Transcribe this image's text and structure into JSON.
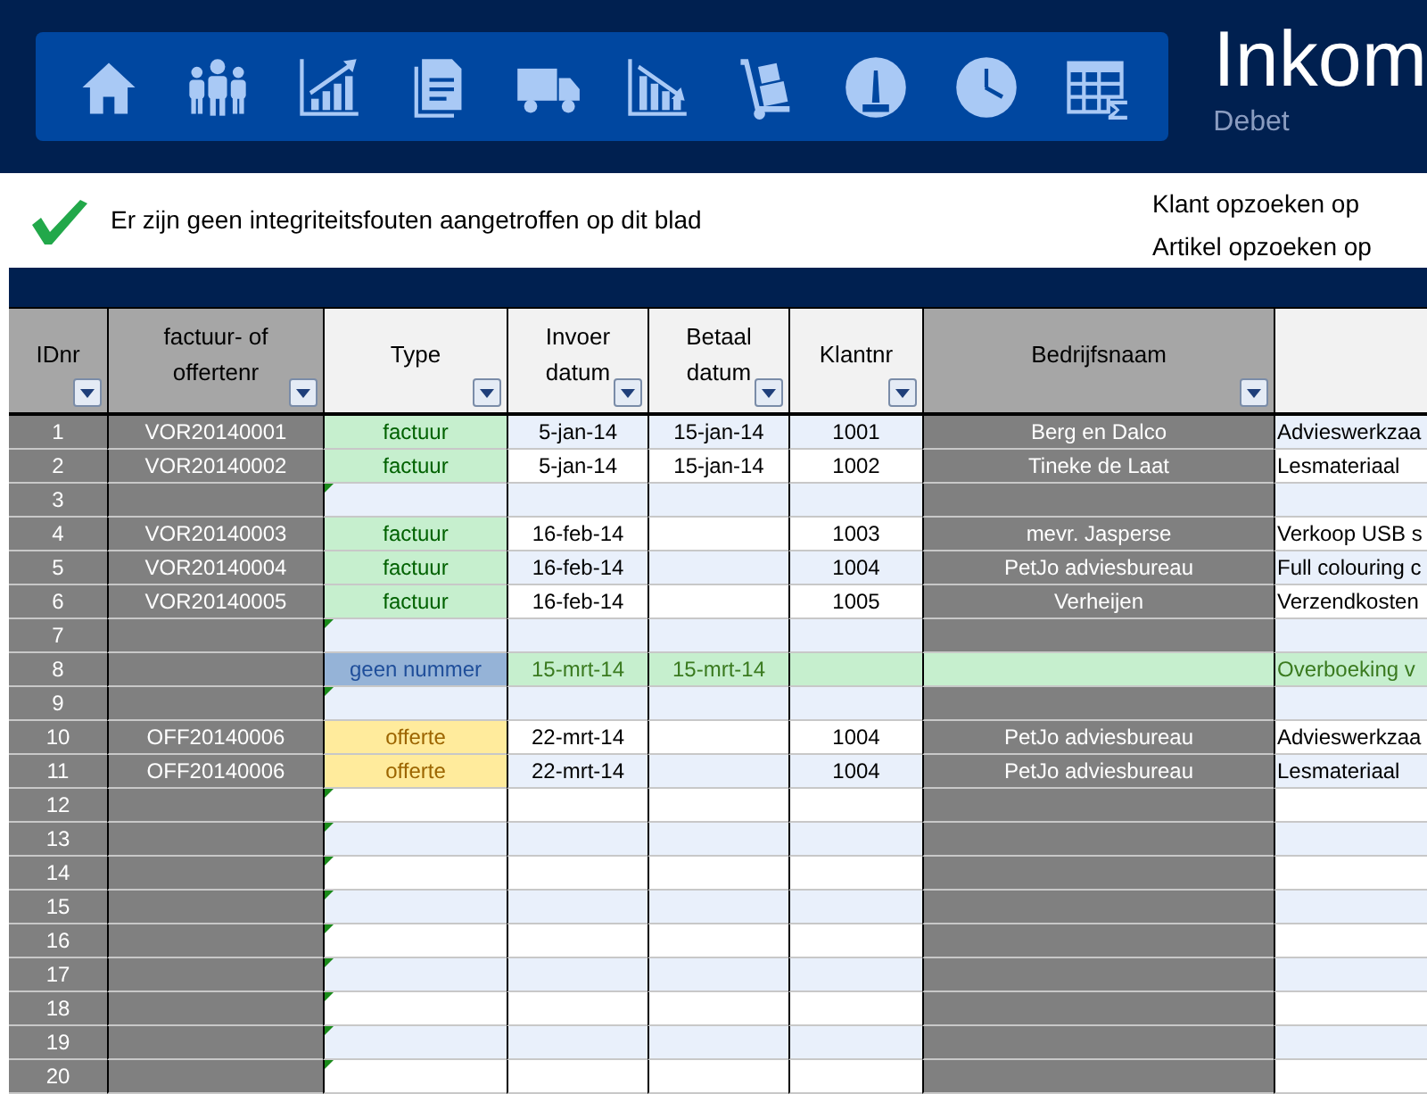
{
  "header": {
    "title": "Inkom",
    "subtitle": "Debet"
  },
  "status": {
    "ok": true,
    "message": "Er zijn geen integriteitsfouten aangetroffen op dit blad"
  },
  "links": [
    "Klant opzoeken op",
    "Artikel opzoeken op"
  ],
  "table": {
    "columns": [
      {
        "label": "IDnr",
        "filter": true,
        "kind": "locked"
      },
      {
        "label": "factuur- of\noffertenr",
        "filter": true,
        "kind": "locked"
      },
      {
        "label": "Type",
        "filter": true,
        "kind": "input"
      },
      {
        "label": "Invoer\ndatum",
        "filter": true,
        "kind": "input"
      },
      {
        "label": "Betaal\ndatum",
        "filter": true,
        "kind": "input"
      },
      {
        "label": "Klantnr",
        "filter": true,
        "kind": "input"
      },
      {
        "label": "Bedrijfsnaam",
        "filter": true,
        "kind": "locked"
      },
      {
        "filter": false,
        "kind": "input"
      }
    ],
    "rows": [
      {
        "highlighted": false,
        "cells": [
          "1",
          "VOR20140001",
          {
            "text": "factuur",
            "kind": "invoice"
          },
          "5-jan-14",
          "15-jan-14",
          "1001",
          "Berg en Dalco",
          "Advieswerkzaa"
        ]
      },
      {
        "highlighted": false,
        "cells": [
          "2",
          "VOR20140002",
          {
            "text": "factuur",
            "kind": "invoice"
          },
          "5-jan-14",
          "15-jan-14",
          "1002",
          "Tineke de Laat",
          "Lesmateriaal"
        ]
      },
      {
        "highlighted": false,
        "cells": [
          "3"
        ]
      },
      {
        "highlighted": false,
        "cells": [
          "4",
          "VOR20140003",
          {
            "text": "factuur",
            "kind": "invoice"
          },
          "16-feb-14",
          null,
          "1003",
          "mevr.  Jasperse",
          "Verkoop USB s"
        ]
      },
      {
        "highlighted": false,
        "cells": [
          "5",
          "VOR20140004",
          {
            "text": "factuur",
            "kind": "invoice"
          },
          "16-feb-14",
          null,
          "1004",
          "PetJo adviesbureau",
          "Full colouring c"
        ]
      },
      {
        "highlighted": false,
        "cells": [
          "6",
          "VOR20140005",
          {
            "text": "factuur",
            "kind": "invoice"
          },
          "16-feb-14",
          null,
          "1005",
          "Verheijen",
          "Verzendkosten"
        ]
      },
      {
        "highlighted": false,
        "cells": [
          "7"
        ]
      },
      {
        "highlighted": true,
        "cells": [
          "8",
          null,
          {
            "text": "geen nummer",
            "kind": "none"
          },
          "15-mrt-14",
          "15-mrt-14",
          null,
          null,
          "Overboeking v"
        ]
      },
      {
        "highlighted": false,
        "cells": [
          "9"
        ]
      },
      {
        "highlighted": false,
        "cells": [
          "10",
          "OFF20140006",
          {
            "text": "offerte",
            "kind": "quote"
          },
          "22-mrt-14",
          null,
          "1004",
          "PetJo adviesbureau",
          "Advieswerkzaa"
        ]
      },
      {
        "highlighted": false,
        "cells": [
          "11",
          "OFF20140006",
          {
            "text": "offerte",
            "kind": "quote"
          },
          "22-mrt-14",
          null,
          "1004",
          "PetJo adviesbureau",
          "Lesmateriaal"
        ]
      },
      {
        "highlighted": false,
        "cells": [
          "12"
        ]
      },
      {
        "highlighted": false,
        "cells": [
          "13"
        ]
      },
      {
        "highlighted": false,
        "cells": [
          "14"
        ]
      },
      {
        "highlighted": false,
        "cells": [
          "15"
        ]
      },
      {
        "highlighted": false,
        "cells": [
          "16"
        ]
      },
      {
        "highlighted": false,
        "cells": [
          "17"
        ]
      },
      {
        "highlighted": false,
        "cells": [
          "18"
        ]
      },
      {
        "highlighted": false,
        "cells": [
          "19"
        ]
      },
      {
        "highlighted": false,
        "cells": [
          "20"
        ]
      }
    ]
  }
}
